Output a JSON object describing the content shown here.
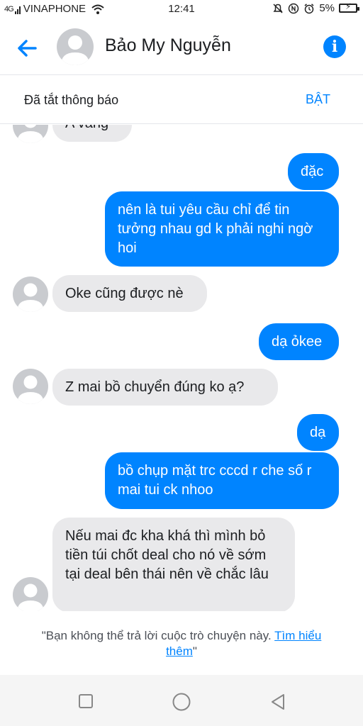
{
  "status_bar": {
    "signal": "4G",
    "carrier": "VINAPHONE",
    "time": "12:41",
    "battery": "5%"
  },
  "header": {
    "contact_name": "Bảo My Nguyễn"
  },
  "notification": {
    "text": "Đã tắt thông báo",
    "button": "BẬT"
  },
  "messages": [
    {
      "side": "in",
      "text": "A vâng"
    },
    {
      "side": "out",
      "text": "đặc"
    },
    {
      "side": "out",
      "text": "nên là tui yêu cầu chỉ để tin tưởng nhau gd k phải nghi ngờ hoi"
    },
    {
      "side": "in",
      "text": "Oke cũng được nè"
    },
    {
      "side": "out",
      "text": "dạ ỏkee"
    },
    {
      "side": "in",
      "text": "Z mai bồ chuyển đúng ko ạ?"
    },
    {
      "side": "out",
      "text": "dạ"
    },
    {
      "side": "out",
      "text": "bồ chụp mặt trc cccd r che số r mai tui ck nhoo"
    },
    {
      "side": "in",
      "text": "Nếu mai đc kha khá thì mình bỏ tiền túi chốt deal cho nó về sớm tại deal bên thái nên về chắc lâu"
    }
  ],
  "footer": {
    "notice": "\"Bạn không thể trả lời cuộc trò chuyện này.",
    "link": "Tìm hiểu thêm",
    "end": "\""
  },
  "colors": {
    "accent": "#0084ff",
    "incoming_bubble": "#e9e9eb",
    "outgoing_bubble": "#0084ff"
  }
}
